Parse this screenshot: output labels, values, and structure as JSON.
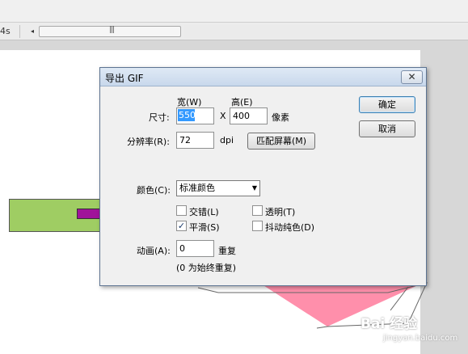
{
  "timeline": {
    "time_label": "4s",
    "scroll_left_glyph": "◂",
    "scroll_grip_glyph": "|||"
  },
  "watermark": {
    "text": "Bai 经验",
    "sub": "jingyan.baidu.com"
  },
  "dialog": {
    "title": "导出 GIF",
    "close_glyph": "✕",
    "size": {
      "label": "尺寸:",
      "width_label": "宽(W)",
      "height_label": "高(E)",
      "width_value": "550",
      "height_value": "400",
      "separator": "X",
      "unit": "像素"
    },
    "resolution": {
      "label": "分辨率(R):",
      "value": "72",
      "unit": "dpi",
      "match_screen_button": "匹配屏幕(M)"
    },
    "ok_button": "确定",
    "cancel_button": "取消",
    "color": {
      "label": "颜色(C):",
      "selected": "标准颜色",
      "arrow_glyph": "▼"
    },
    "options": {
      "interlace": {
        "label": "交错(L)",
        "checked": false
      },
      "transparent": {
        "label": "透明(T)",
        "checked": false
      },
      "smooth": {
        "label": "平滑(S)",
        "checked": true
      },
      "dither": {
        "label": "抖动纯色(D)",
        "checked": false
      },
      "check_glyph": "✓"
    },
    "animation": {
      "label": "动画(A):",
      "value": "0",
      "unit": "重复",
      "hint": "(0 为始终重复)"
    }
  },
  "colors": {
    "green_shape": "#9fcd63",
    "purple_shape": "#a0139a",
    "pink_shape": "#ff8fab",
    "selection": "#3399ff"
  }
}
